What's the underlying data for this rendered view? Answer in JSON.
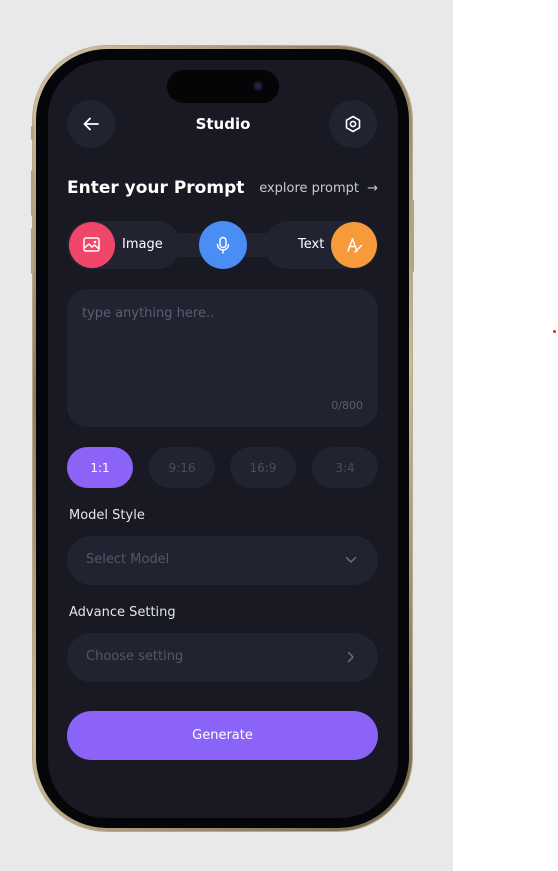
{
  "header": {
    "title": "Studio",
    "back_icon": "arrow-left-icon",
    "settings_icon": "settings-icon"
  },
  "prompt": {
    "heading": "Enter your Prompt",
    "explore_link": "explore prompt",
    "explore_arrow": "→",
    "placeholder": "type anything here..",
    "counter": "0/800"
  },
  "modes": [
    {
      "label": "Image",
      "icon": "image-icon",
      "color": "#f0466a"
    },
    {
      "label": "",
      "icon": "microphone-icon",
      "color": "#4a8df4"
    },
    {
      "label": "Text",
      "icon": "text-pen-icon",
      "color": "#f79a3c"
    }
  ],
  "ratios": [
    {
      "label": "1:1",
      "selected": true
    },
    {
      "label": "9:16",
      "selected": false
    },
    {
      "label": "16:9",
      "selected": false
    },
    {
      "label": "3:4",
      "selected": false
    }
  ],
  "model_style": {
    "label": "Model Style",
    "placeholder": "Select Model",
    "icon": "chevron-down-icon"
  },
  "advance_setting": {
    "label": "Advance Setting",
    "placeholder": "Choose setting",
    "icon": "chevron-right-icon"
  },
  "generate_label": "Generate",
  "colors": {
    "background": "#181923",
    "surface": "#222331",
    "accent": "#8b63f6"
  }
}
